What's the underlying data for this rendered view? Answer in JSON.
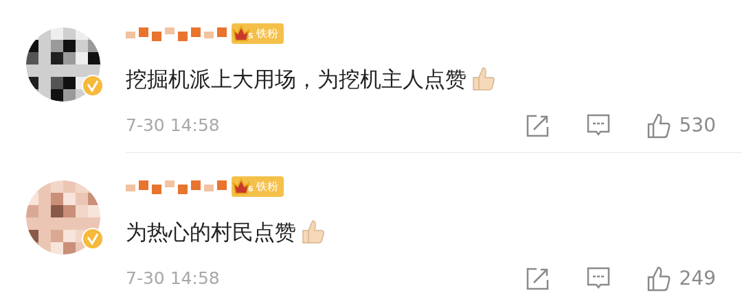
{
  "comments": [
    {
      "verified": true,
      "badge": {
        "rank": "5",
        "label": "铁粉"
      },
      "text": "挖掘机派上大用场，为挖机主人点赞",
      "time": "7-30 14:58",
      "likes": "530"
    },
    {
      "verified": true,
      "badge": {
        "rank": "6",
        "label": "铁粉"
      },
      "text": "为热心的村民点赞",
      "time": "7-30 14:58",
      "likes": "249"
    }
  ]
}
